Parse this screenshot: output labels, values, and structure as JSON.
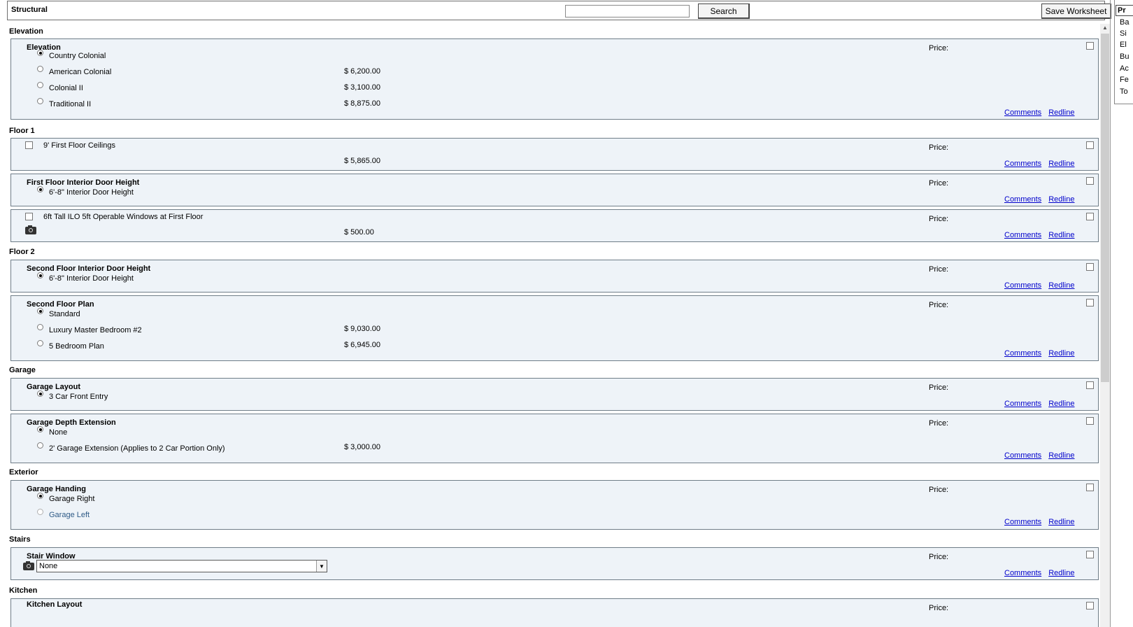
{
  "header": {
    "title": "Structural",
    "search_placeholder": "",
    "search_label": "Search",
    "save_label": "Save Worksheet"
  },
  "labels": {
    "price": "Price:",
    "comments": "Comments",
    "redline": "Redline"
  },
  "right_panel": {
    "heading": "Pr",
    "items": [
      "Ba",
      "Si",
      "El",
      "Bu",
      "Ac",
      "Fe",
      "To"
    ]
  },
  "categories": {
    "elevation": "Elevation",
    "floor1": "Floor 1",
    "floor2": "Floor 2",
    "garage": "Garage",
    "exterior": "Exterior",
    "stairs": "Stairs",
    "kitchen": "Kitchen"
  },
  "options": {
    "elevation": {
      "title": "Elevation",
      "choices": [
        {
          "label": "Country Colonial",
          "price": "",
          "selected": true
        },
        {
          "label": "American Colonial",
          "price": "$ 6,200.00",
          "selected": false
        },
        {
          "label": "Colonial II",
          "price": "$ 3,100.00",
          "selected": false
        },
        {
          "label": "Traditional II",
          "price": "$ 8,875.00",
          "selected": false
        }
      ]
    },
    "ceilings": {
      "label": "9' First Floor Ceilings",
      "price": "$ 5,865.00"
    },
    "first_door": {
      "title": "First Floor Interior Door Height",
      "choices": [
        {
          "label": "6'-8\" Interior Door Height",
          "selected": true
        }
      ]
    },
    "windows": {
      "label": "6ft Tall ILO 5ft Operable Windows at First Floor",
      "price": "$ 500.00"
    },
    "second_door": {
      "title": "Second Floor Interior Door Height",
      "choices": [
        {
          "label": "6'-8\" Interior Door Height",
          "selected": true
        }
      ]
    },
    "second_plan": {
      "title": "Second Floor Plan",
      "choices": [
        {
          "label": "Standard",
          "price": "",
          "selected": true
        },
        {
          "label": "Luxury Master Bedroom #2",
          "price": "$ 9,030.00",
          "selected": false
        },
        {
          "label": "5 Bedroom Plan",
          "price": "$ 6,945.00",
          "selected": false
        }
      ]
    },
    "garage_layout": {
      "title": "Garage Layout",
      "choices": [
        {
          "label": "3 Car Front Entry",
          "selected": true
        }
      ]
    },
    "garage_depth": {
      "title": "Garage Depth Extension",
      "choices": [
        {
          "label": "None",
          "price": "",
          "selected": true
        },
        {
          "label": "2' Garage Extension (Applies to 2 Car Portion Only)",
          "price": "$ 3,000.00",
          "selected": false
        }
      ]
    },
    "garage_handing": {
      "title": "Garage Handing",
      "choices": [
        {
          "label": "Garage Right",
          "selected": true
        },
        {
          "label": "Garage Left",
          "selected": false
        }
      ]
    },
    "stair_window": {
      "title": "Stair Window",
      "value": "None"
    },
    "kitchen_layout": {
      "title": "Kitchen Layout"
    }
  }
}
